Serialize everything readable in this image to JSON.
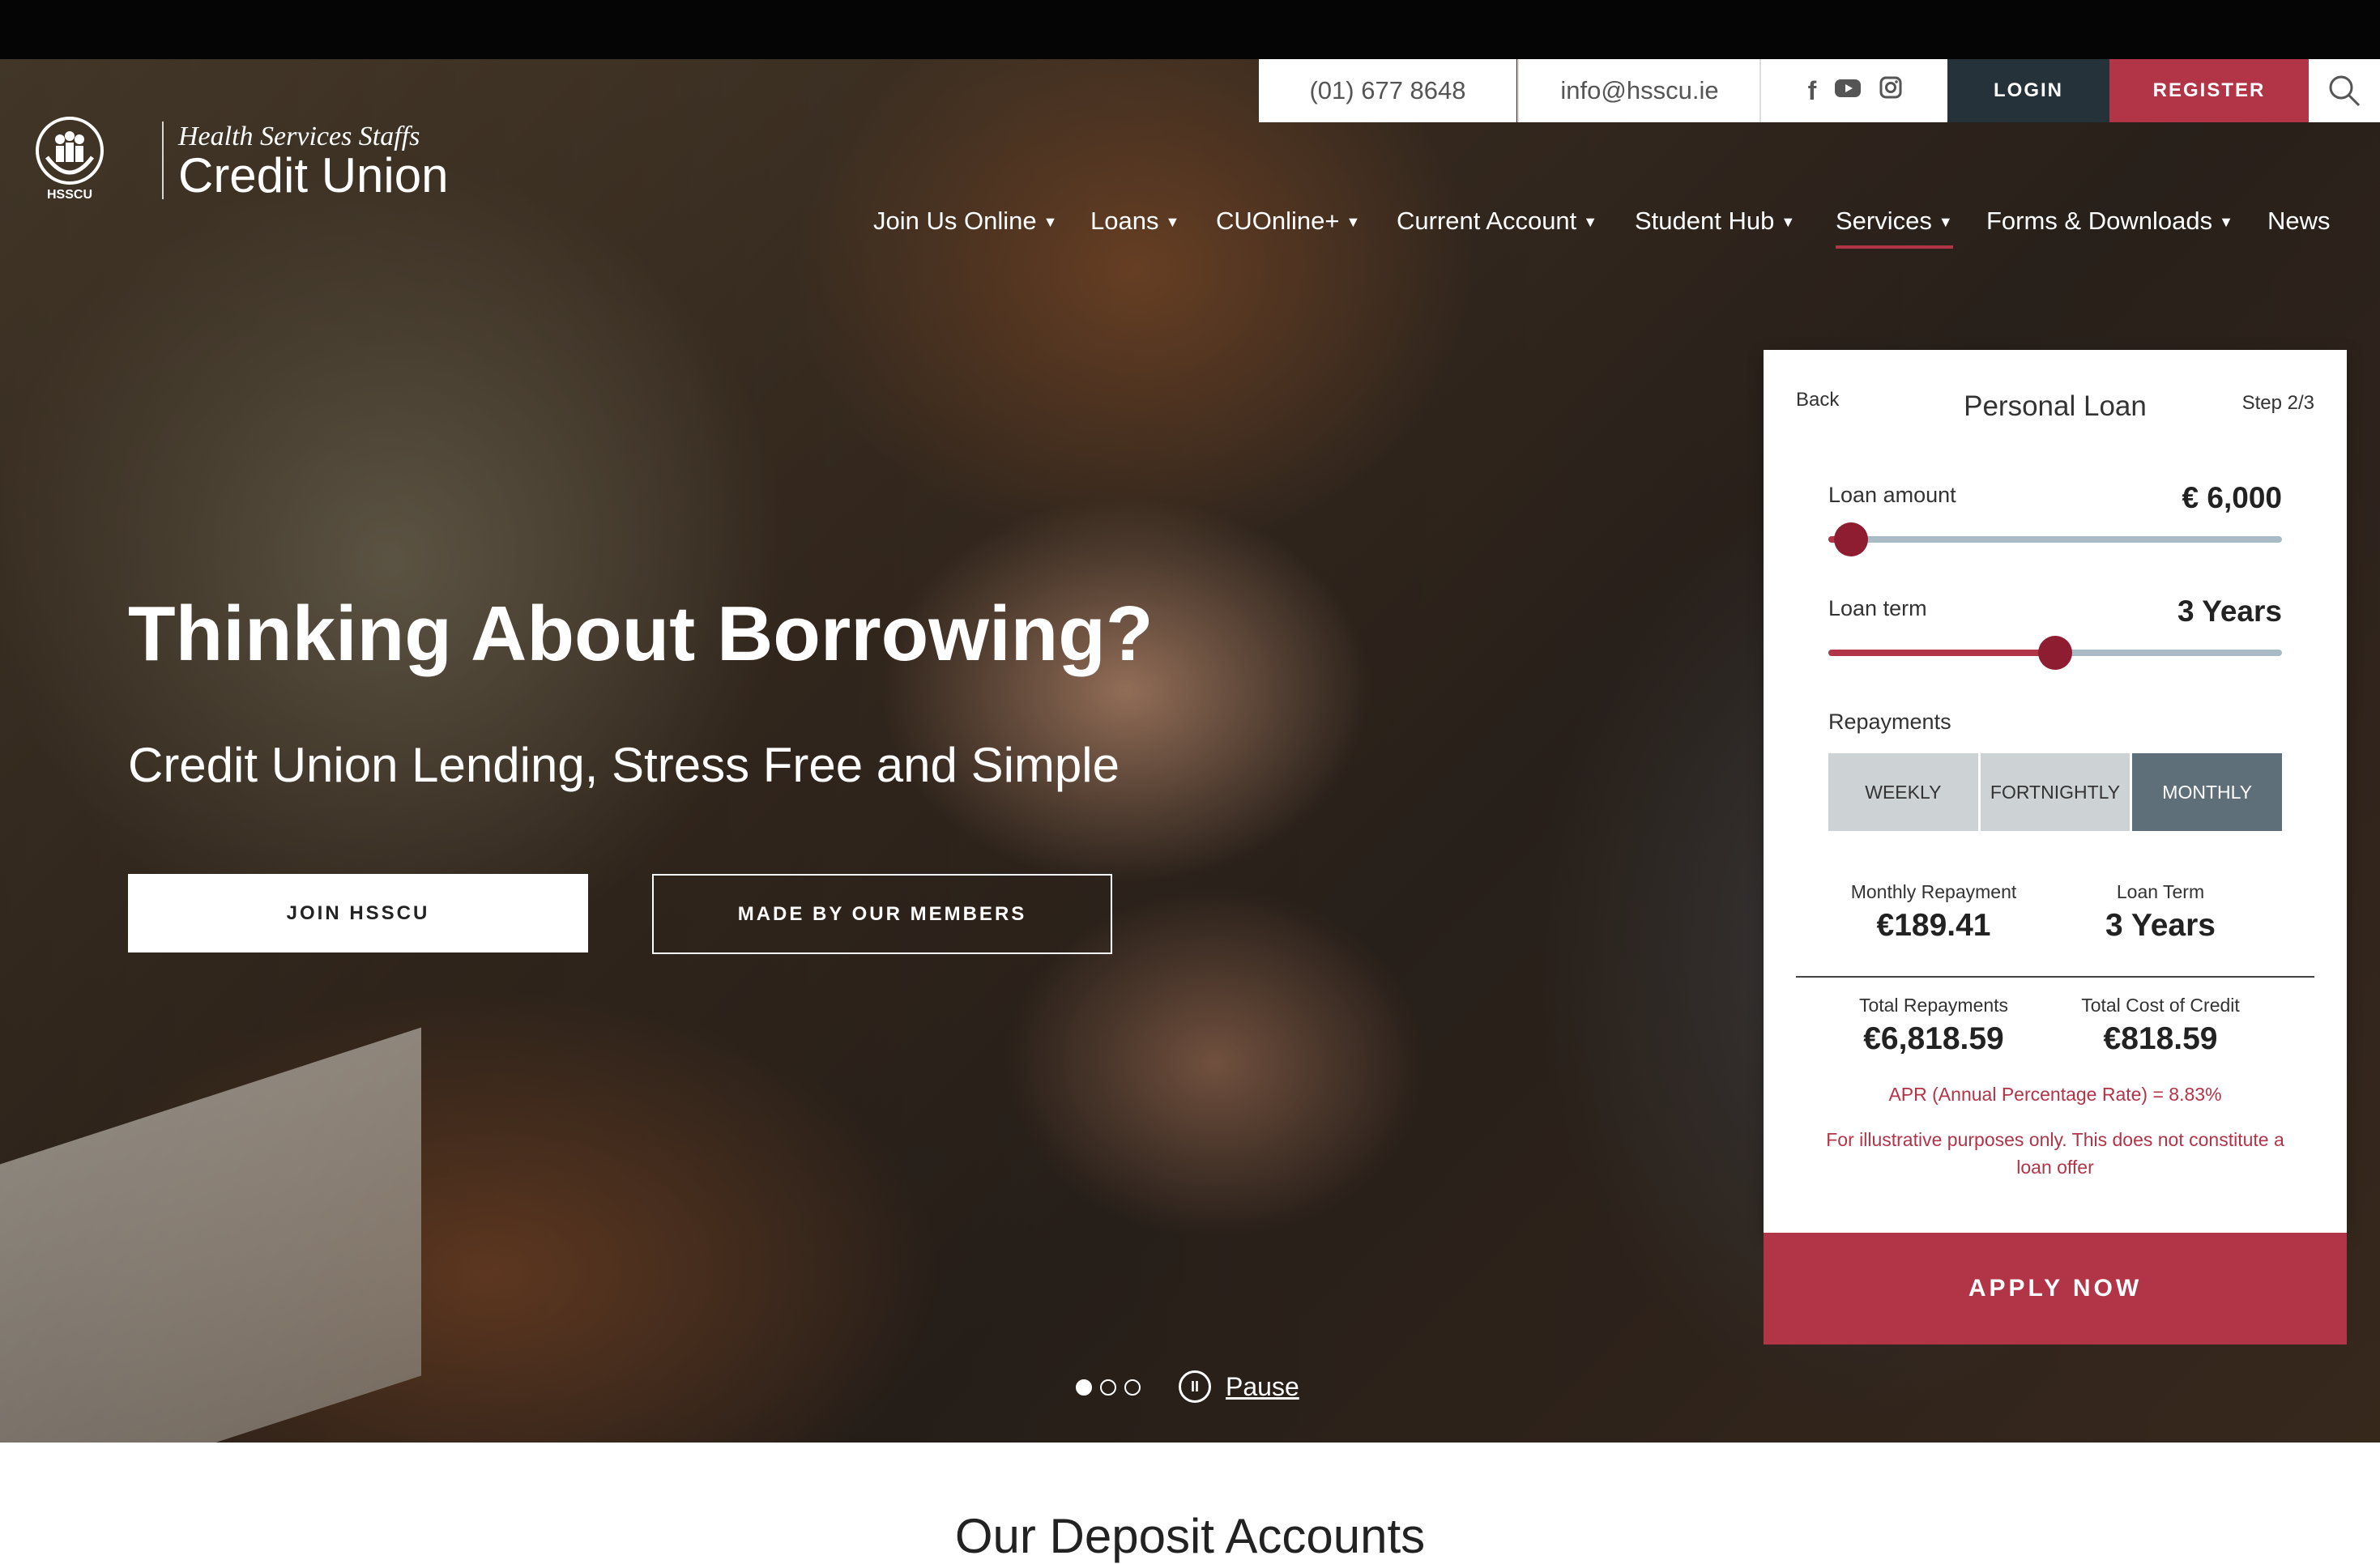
{
  "header": {
    "phone": "(01) 677 8648",
    "email": "info@hsscu.ie",
    "login_label": "LOGIN",
    "register_label": "REGISTER"
  },
  "logo": {
    "line1": "Health Services Staffs",
    "line2": "Credit Union",
    "abbr": "HSSCU"
  },
  "nav": {
    "items": [
      {
        "label": "Join Us Online"
      },
      {
        "label": "Loans"
      },
      {
        "label": "CUOnline+"
      },
      {
        "label": "Current Account"
      },
      {
        "label": "Student Hub"
      },
      {
        "label": "Services"
      },
      {
        "label": "Forms & Downloads"
      },
      {
        "label": "News"
      }
    ]
  },
  "hero": {
    "title": "Thinking About Borrowing?",
    "subtitle": "Credit Union Lending, Stress Free and Simple",
    "join_label": "JOIN HSSCU",
    "made_label": "MADE BY OUR MEMBERS",
    "pause_label": "Pause",
    "slide_count": 3,
    "active_slide": 1
  },
  "calculator": {
    "back_label": "Back",
    "title": "Personal Loan",
    "step": "Step 2/3",
    "loan_amount_label": "Loan amount",
    "loan_amount_value": "€ 6,000",
    "loan_amount_fraction": 0.05,
    "loan_term_label": "Loan term",
    "loan_term_value": "3 Years",
    "loan_term_fraction": 0.5,
    "repayments_label": "Repayments",
    "frequency": [
      "WEEKLY",
      "FORTNIGHTLY",
      "MONTHLY"
    ],
    "selected_frequency": "MONTHLY",
    "monthly_repayment_label": "Monthly Repayment",
    "monthly_repayment_value": "€189.41",
    "loan_term_result_label": "Loan Term",
    "loan_term_result_value": "3 Years",
    "total_repayments_label": "Total Repayments",
    "total_repayments_value": "€6,818.59",
    "total_cost_label": "Total Cost of Credit",
    "total_cost_value": "€818.59",
    "apr_text": "APR (Annual Percentage Rate) = 8.83%",
    "disclaimer": "For illustrative purposes only. This does not constitute a loan offer",
    "apply_label": "APPLY NOW"
  },
  "section": {
    "title": "Our Deposit Accounts"
  },
  "colors": {
    "brand_red": "#b23447",
    "slider_thumb": "#8e1d31",
    "dark_slate": "#25323a"
  }
}
